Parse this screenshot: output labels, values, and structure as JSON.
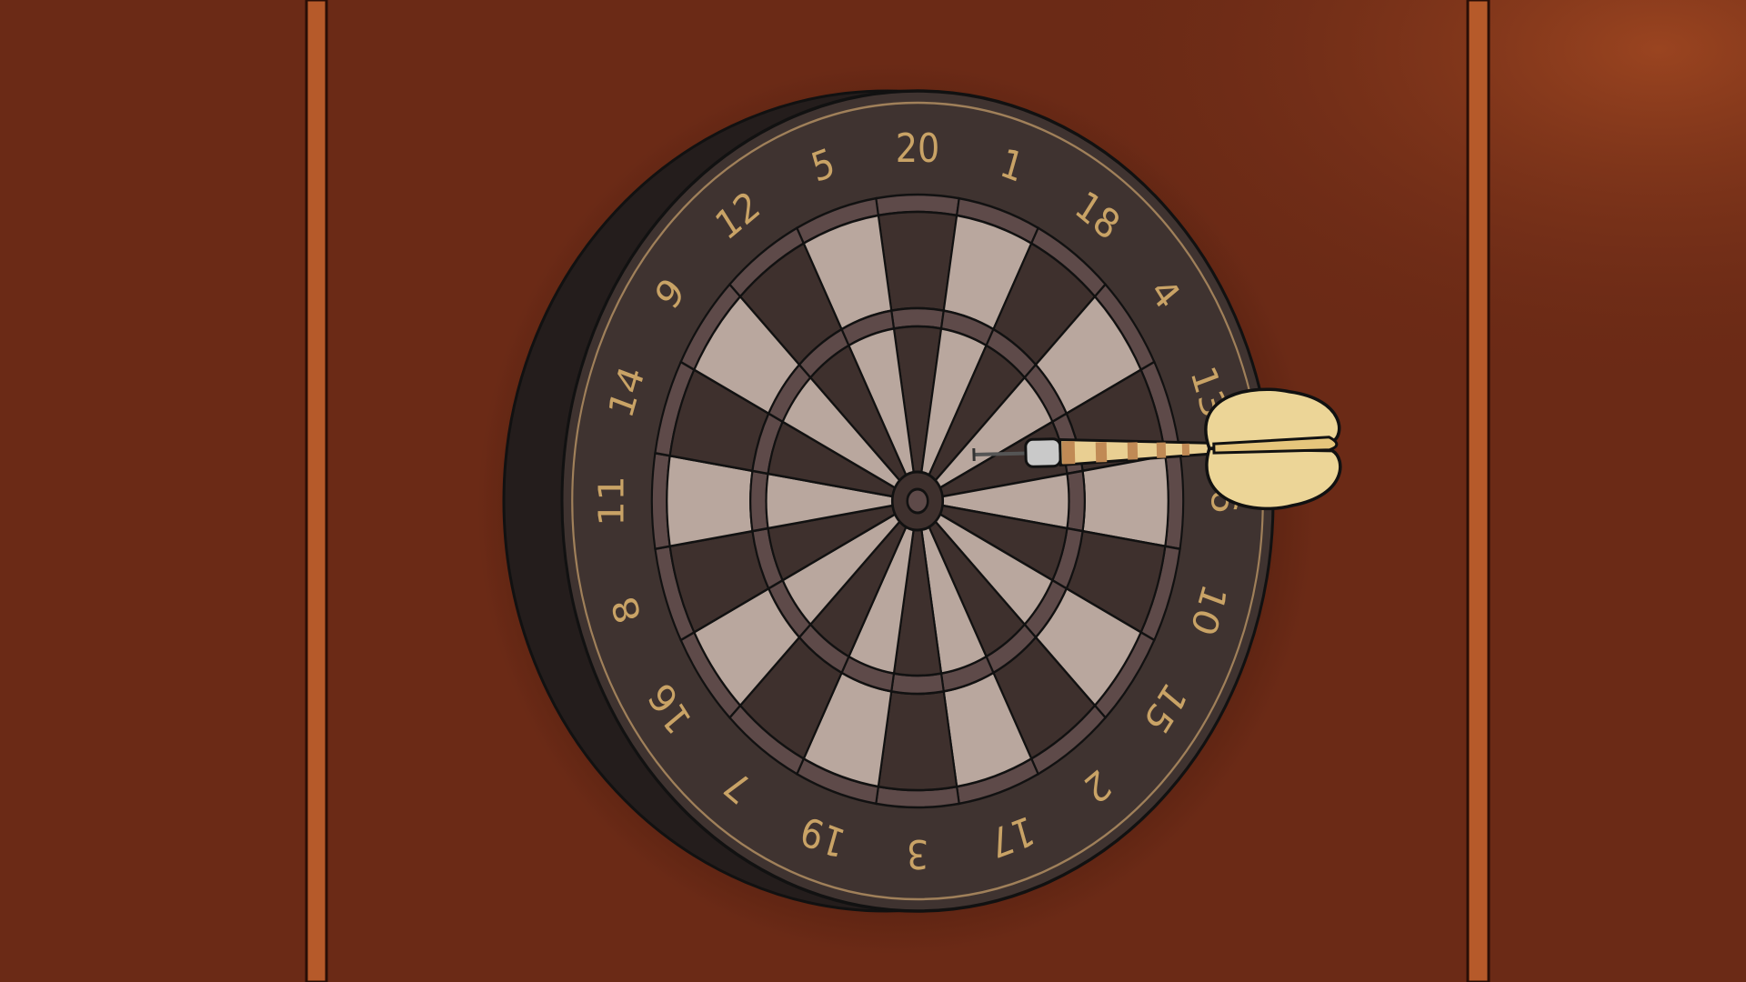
{
  "scene": {
    "wall_color": "#6b2a16",
    "trim_color": "#b65a2a",
    "board_numbers": [
      "20",
      "1",
      "18",
      "4",
      "13",
      "6",
      "10",
      "15",
      "2",
      "17",
      "3",
      "19",
      "7",
      "16",
      "8",
      "11",
      "14",
      "9",
      "12",
      "5"
    ],
    "segment_light": "#b9a79e",
    "segment_dark": "#3e302d",
    "ring_color": "#5e4a49",
    "number_color": "#c9a366",
    "dart": {
      "target_number": "6",
      "flight_color": "#ecd597",
      "barrel_color": "#e9cf92"
    }
  }
}
